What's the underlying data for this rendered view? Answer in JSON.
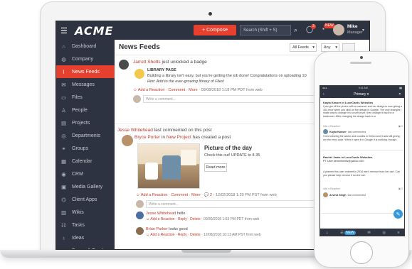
{
  "app": {
    "brand": "ACME",
    "compose_label": "Compose",
    "search_placeholder": "Search (Shift + S)",
    "notif_count": "3",
    "flag_badge": "NEW",
    "user_name": "Mike",
    "user_role": "Manager"
  },
  "colors": {
    "accent": "#e8402e",
    "sidebar_bg": "#2d3340",
    "link": "#c0392b",
    "phone_fab": "#3498db"
  },
  "sidebar": {
    "items": [
      {
        "label": "Dashboard",
        "icon": "home-icon"
      },
      {
        "label": "Company",
        "icon": "globe-icon"
      },
      {
        "label": "News Feeds",
        "icon": "rss-icon",
        "active": true
      },
      {
        "label": "Messages",
        "icon": "envelope-icon"
      },
      {
        "label": "Files",
        "icon": "file-icon"
      },
      {
        "label": "People",
        "icon": "person-icon"
      },
      {
        "label": "Projects",
        "icon": "folder-icon"
      },
      {
        "label": "Departments",
        "icon": "departments-icon"
      },
      {
        "label": "Groups",
        "icon": "groups-icon"
      },
      {
        "label": "Calendar",
        "icon": "calendar-icon"
      },
      {
        "label": "CRM",
        "icon": "crm-icon"
      },
      {
        "label": "Media Gallery",
        "icon": "media-icon"
      },
      {
        "label": "Client Apps",
        "icon": "client-apps-icon"
      },
      {
        "label": "Wikis",
        "icon": "wiki-icon"
      },
      {
        "label": "Tasks",
        "icon": "tasks-icon"
      },
      {
        "label": "Ideas",
        "icon": "bulb-icon"
      },
      {
        "label": "Forms & Trackers",
        "icon": "forms-icon"
      }
    ]
  },
  "feed": {
    "title": "News Feeds",
    "filter_all": "All Feeds",
    "filter_any": "Any",
    "post1": {
      "author": "Jarrett Shotts",
      "action": "just unlocked a badge",
      "badge_title": "LIBRARY PAGE",
      "badge_text": "Building a library isn't easy, but you're getting the job done! Congratulations on uploading 10",
      "hint": "Hint: Add to the ever-growing library of Files!",
      "add_reaction": "Add a Reaction",
      "comment": "Comment",
      "more": "More",
      "timestamp": "09/08/2018 1:18 PM PDT from web",
      "comment_placeholder": "Write a comment..."
    },
    "post2": {
      "author": "Jesse Whitehead",
      "action": "last commented on this post",
      "poster": "Bryce Porter",
      "in_label": "in",
      "project": "New Project",
      "created": "has created a post",
      "picture_title": "Picture of the day",
      "picture_text": "Check this out! UPDATE to 8-35",
      "read_more": "Read more",
      "add_reaction": "Add a Reaction",
      "comment": "Comment",
      "more": "More",
      "comment_count": "2",
      "timestamp": "12/02/2018 1:20 PM PST from web",
      "comment_placeholder": "Write a comment..."
    },
    "replies": [
      {
        "author": "Jesse Whitehead",
        "text": "hello",
        "add_reaction": "Add a Reaction",
        "reply": "Reply",
        "delete": "Delete",
        "timestamp": "09/30/2018 1:53 PM PDT from web"
      },
      {
        "author": "Brian Parker",
        "text": "looks good",
        "add_reaction": "Add a Reaction",
        "reply": "Reply",
        "delete": "Delete",
        "timestamp": "12/08/2018 10:13 AM PST from web"
      }
    ]
  },
  "phone": {
    "time": "9:41 AM",
    "title": "Primary",
    "card1": {
      "header": "Kayla Kasser in LuxeCards Websites",
      "body": "I just got off the phone with a customer and her design is now giving a 404 error when you click on the design in Google. The only changes I made was to change it to a soft cover, then change it back to a hardcover. After changing the design back to a",
      "add_reaction": "Add a Reaction",
      "comment_count": "2",
      "reply_author": "Kayla Kasser",
      "reply_action": "last commented",
      "reply_text": "I tried clearing the cache and cookies in firefox and it was still giving me the error code. When I open it in Google it is working, though."
    },
    "card2": {
      "header": "Rachel Jams in LuxeCards Websites",
      "subheader": "PT User kemmitohits@yahoo.com",
      "body": "A planner this user ordered in 2016 won't remove from her cart. Can you please help remove it so she can",
      "add_reaction": "Add a Reaction",
      "comment_count": "2",
      "reply_author": "Arvind Singh",
      "reply_action": "last commented"
    },
    "tab_badge": "NEW"
  }
}
